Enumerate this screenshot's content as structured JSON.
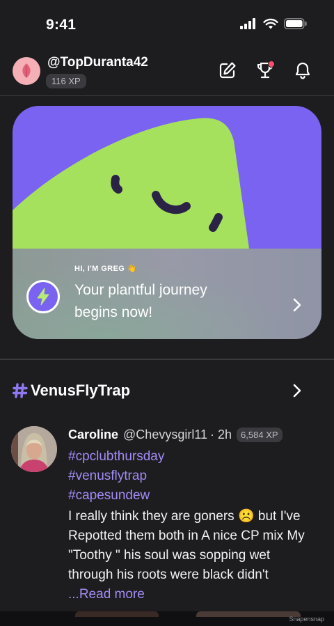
{
  "status_bar": {
    "time": "9:41"
  },
  "profile": {
    "username": "@TopDuranta42",
    "xp": "116 XP"
  },
  "greg_card": {
    "eyebrow": "HI, I'M GREG 👋",
    "title": "Your plantful journey begins now!"
  },
  "channel": {
    "name": "VenusFlyTrap"
  },
  "post": {
    "author": "Caroline",
    "handle": "@Chevysgirl11",
    "time": "· 2h",
    "xp": "6,584 XP",
    "tags": [
      "#cpclubthursday",
      "#venusflytrap",
      "#capesundew"
    ],
    "body": "I really think they are goners ☹️ but I've Repotted them both in A nice CP mix My \"Toothy \" his soul was sopping wet through his roots were black didn't ",
    "read_more": "...Read more"
  },
  "watermark": "Snapensnap",
  "colors": {
    "background": "#1d1c1f",
    "accent": "#7a63f0",
    "link": "#a38cf5",
    "mascot": "#a6e15d",
    "notification": "#ff4f6d"
  },
  "icons": [
    "cellular-signal-icon",
    "wifi-icon",
    "battery-icon",
    "leaf-icon",
    "compose-icon",
    "trophy-icon",
    "bell-icon",
    "bolt-icon",
    "chevron-right-icon",
    "hashtag-icon"
  ]
}
